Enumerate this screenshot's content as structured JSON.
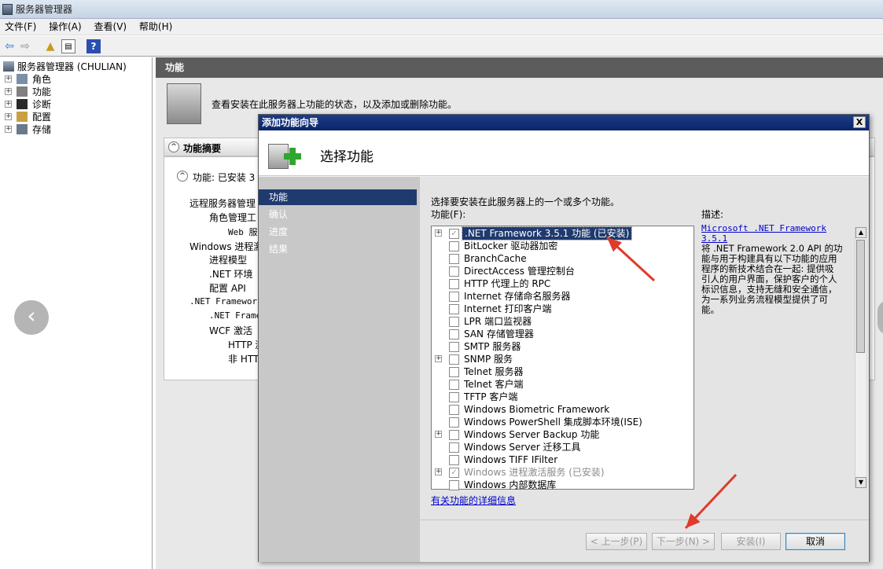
{
  "app": {
    "title": "服务器管理器"
  },
  "menu": [
    "文件(F)",
    "操作(A)",
    "查看(V)",
    "帮助(H)"
  ],
  "toolbar_icons": [
    "back-icon",
    "forward-icon",
    "up-folder-icon",
    "show-hide-console-tree-icon",
    "help-icon"
  ],
  "tree": {
    "root": "服务器管理器 (CHULIAN)",
    "items": [
      "角色",
      "功能",
      "诊断",
      "配置",
      "存储"
    ]
  },
  "right_pane": {
    "header": "功能",
    "description": "查看安装在此服务器上功能的状态，以及添加或删除功能。",
    "summary_title": "功能摘要",
    "features_status": "功能: 已安装 3",
    "bg_lines": [
      "远程服务器管理",
      "角色管理工",
      "Web 服",
      "Windows 进程激",
      "进程模型",
      ".NET 环境",
      "配置 API",
      ".NET Framework",
      ".NET Frame",
      "WCF 激活",
      "HTTP 激",
      "非 HTT"
    ]
  },
  "dialog": {
    "title": "添加功能向导",
    "heading": "选择功能",
    "close_label": "X",
    "nav": [
      "功能",
      "确认",
      "进度",
      "结果"
    ],
    "instruction": "选择要安装在此服务器上的一个或多个功能。",
    "features_label": "功能(F):",
    "features": [
      {
        "label": ".NET Framework 3.5.1 功能  (已安装)",
        "expandable": true,
        "checked": true,
        "disabled": true,
        "selected": true
      },
      {
        "label": "BitLocker 驱动器加密",
        "expandable": false,
        "checked": false
      },
      {
        "label": "BranchCache",
        "expandable": false,
        "checked": false
      },
      {
        "label": "DirectAccess 管理控制台",
        "expandable": false,
        "checked": false
      },
      {
        "label": "HTTP 代理上的 RPC",
        "expandable": false,
        "checked": false
      },
      {
        "label": "Internet 存储命名服务器",
        "expandable": false,
        "checked": false
      },
      {
        "label": "Internet 打印客户端",
        "expandable": false,
        "checked": false
      },
      {
        "label": "LPR 端口监视器",
        "expandable": false,
        "checked": false
      },
      {
        "label": "SAN 存储管理器",
        "expandable": false,
        "checked": false
      },
      {
        "label": "SMTP 服务器",
        "expandable": false,
        "checked": false
      },
      {
        "label": "SNMP 服务",
        "expandable": true,
        "checked": false
      },
      {
        "label": "Telnet 服务器",
        "expandable": false,
        "checked": false
      },
      {
        "label": "Telnet 客户端",
        "expandable": false,
        "checked": false
      },
      {
        "label": "TFTP 客户端",
        "expandable": false,
        "checked": false
      },
      {
        "label": "Windows Biometric Framework",
        "expandable": false,
        "checked": false
      },
      {
        "label": "Windows PowerShell 集成脚本环境(ISE)",
        "expandable": false,
        "checked": false
      },
      {
        "label": "Windows Server Backup 功能",
        "expandable": true,
        "checked": false
      },
      {
        "label": "Windows Server 迁移工具",
        "expandable": false,
        "checked": false
      },
      {
        "label": "Windows TIFF IFilter",
        "expandable": false,
        "checked": false
      },
      {
        "label": "Windows 进程激活服务  (已安装)",
        "expandable": true,
        "checked": true,
        "disabled": true
      },
      {
        "label": "Windows 内部数据库",
        "expandable": false,
        "checked": false
      }
    ],
    "description_label": "描述:",
    "description_link": "Microsoft .NET Framework 3.5.1",
    "description_lines": [
      "将 .NET Framework 2.0 API 的功",
      "能与用于构建具有以下功能的应用",
      "程序的新技术结合在一起: 提供吸",
      "引人的用户界面，保护客户的个人",
      "标识信息，支持无缝和安全通信，",
      "为一系列业务流程模型提供了可",
      "能。"
    ],
    "more_info_link": "有关功能的详细信息",
    "buttons": {
      "prev": "< 上一步(P)",
      "next": "下一步(N) >",
      "install": "安装(I)",
      "cancel": "取消"
    }
  },
  "colors": {
    "selection": "#1f3a6e",
    "annotation_arrow": "#e03a2a"
  }
}
